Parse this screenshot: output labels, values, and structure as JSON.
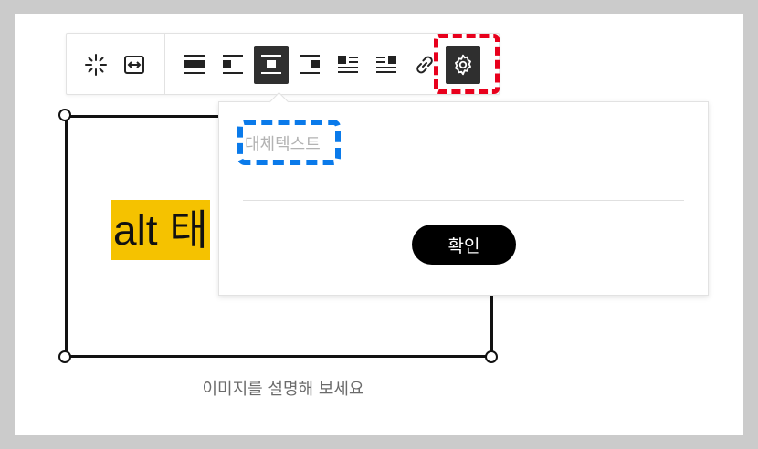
{
  "toolbar": {
    "buttons": [
      {
        "icon": "sparkle-icon"
      },
      {
        "icon": "fit-width-icon"
      },
      {
        "icon": "align-full-width-icon"
      },
      {
        "icon": "align-left-icon"
      },
      {
        "icon": "align-center-icon",
        "active": true
      },
      {
        "icon": "align-right-icon"
      },
      {
        "icon": "wrap-left-icon"
      },
      {
        "icon": "wrap-right-icon"
      },
      {
        "icon": "link-icon"
      },
      {
        "icon": "gear-icon",
        "active": true
      }
    ],
    "active_color": "#2f2f2f",
    "highlight_color": "#e8001c"
  },
  "image": {
    "alt_tag_text": "alt 태",
    "highlight_color": "#f5c200"
  },
  "caption": {
    "placeholder": "이미지를 설명해 보세요"
  },
  "popover": {
    "alt_input": {
      "value": "",
      "placeholder": "대체텍스트"
    },
    "highlight_color": "#0a7aea",
    "confirm_label": "확인"
  }
}
